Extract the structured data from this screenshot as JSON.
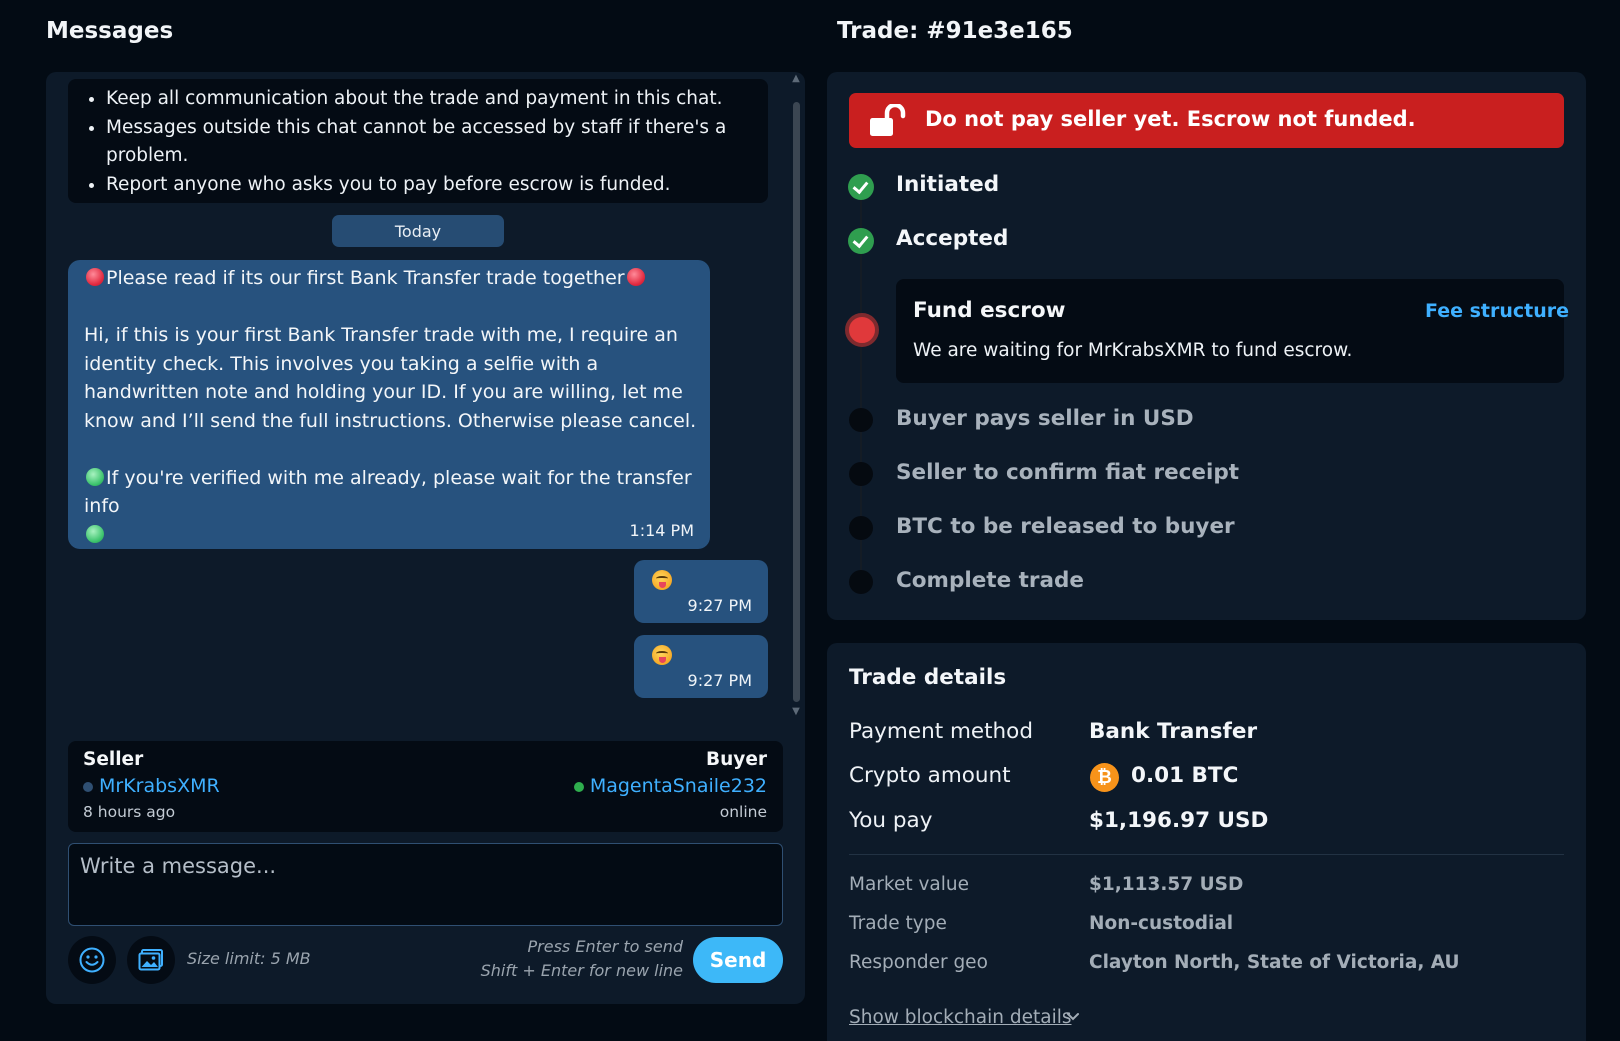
{
  "messages_panel": {
    "title": "Messages",
    "rules": [
      "Keep all communication about the trade and payment in this chat.",
      "Messages outside this chat cannot be accessed by staff if there's a problem.",
      "Report anyone who asks you to pay before escrow is funded."
    ],
    "date_divider": "Today",
    "incoming_message": {
      "line1": "Please read if its our first Bank Transfer trade together",
      "paragraph2": "Hi, if this is your first Bank Transfer trade with me, I require an identity check. This involves you taking a selfie with a handwritten note and holding your ID. If you are willing, let me know and I’ll send the full instructions. Otherwise please cancel.",
      "paragraph3": "If you're verified with me already, please wait for the transfer info",
      "time": "1:14 PM"
    },
    "outgoing_messages": [
      {
        "emoji": "face-with-tongue",
        "time": "9:27 PM"
      },
      {
        "emoji": "face-with-tongue",
        "time": "9:27 PM"
      }
    ],
    "parties": {
      "seller_label": "Seller",
      "seller_name": "MrKrabsXMR",
      "seller_status": "8 hours ago",
      "buyer_label": "Buyer",
      "buyer_name": "MagentaSnaile232",
      "buyer_status": "online"
    },
    "composer": {
      "placeholder": "Write a message...",
      "size_limit": "Size limit: 5 MB",
      "hint_enter": "Press Enter to send",
      "hint_shift": "Shift + Enter for new line",
      "send_label": "Send"
    }
  },
  "trade_panel": {
    "title": "Trade: #91e3e165",
    "alert": "Do not pay seller yet. Escrow not funded.",
    "steps": [
      {
        "label": "Initiated",
        "state": "done"
      },
      {
        "label": "Accepted",
        "state": "done"
      },
      {
        "label": "Fund escrow",
        "state": "active"
      },
      {
        "label": "Buyer pays seller in USD",
        "state": "pending"
      },
      {
        "label": "Seller to confirm fiat receipt",
        "state": "pending"
      },
      {
        "label": "BTC to be released to buyer",
        "state": "pending"
      },
      {
        "label": "Complete trade",
        "state": "pending"
      }
    ],
    "active_step": {
      "title": "Fund escrow",
      "link": "Fee structure",
      "description": "We are waiting for MrKrabsXMR to fund escrow."
    }
  },
  "trade_details": {
    "title": "Trade details",
    "payment_method_label": "Payment method",
    "payment_method": "Bank Transfer",
    "crypto_amount_label": "Crypto amount",
    "crypto_amount": "0.01 BTC",
    "crypto_icon_glyph": "₿",
    "you_pay_label": "You pay",
    "you_pay": "$1,196.97 USD",
    "market_value_label": "Market value",
    "market_value": "$1,113.57 USD",
    "trade_type_label": "Trade type",
    "trade_type": "Non-custodial",
    "responder_geo_label": "Responder geo",
    "responder_geo": "Clayton North, State of Victoria, AU",
    "show_blockchain": "Show blockchain details"
  },
  "colors": {
    "background": "#030b14",
    "panel": "#0d1a29",
    "message_bubble": "#27527e",
    "link": "#3fb0ff",
    "alert": "#c91f1f",
    "success": "#2f9e4f",
    "send_button": "#3db8f8"
  }
}
